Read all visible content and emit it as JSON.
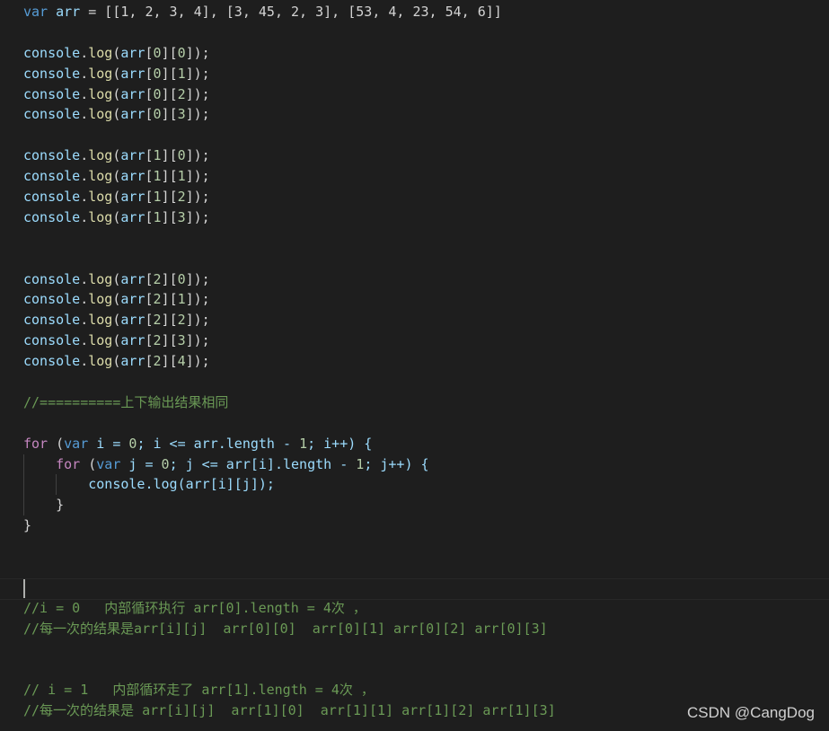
{
  "code": {
    "line_arr": {
      "kw": "var",
      "name": "arr",
      "rest": " = [[1, 2, 3, 4], [3, 45, 2, 3], [53, 4, 23, 54, 6]]"
    },
    "log_lines": [
      {
        "i": "0",
        "j": "0"
      },
      {
        "i": "0",
        "j": "1"
      },
      {
        "i": "0",
        "j": "2"
      },
      {
        "i": "0",
        "j": "3"
      },
      {
        "i": "1",
        "j": "0"
      },
      {
        "i": "1",
        "j": "1"
      },
      {
        "i": "1",
        "j": "2"
      },
      {
        "i": "1",
        "j": "3"
      },
      {
        "i": "2",
        "j": "0"
      },
      {
        "i": "2",
        "j": "1"
      },
      {
        "i": "2",
        "j": "2"
      },
      {
        "i": "2",
        "j": "3"
      },
      {
        "i": "2",
        "j": "4"
      }
    ],
    "comment_same": "//==========上下输出结果相同",
    "outer_for": {
      "kw": "for",
      "open": " (",
      "var": "var",
      "rest1": " i = ",
      "zero": "0",
      "rest2": "; i <= arr.length - ",
      "one": "1",
      "rest3": "; i++) {"
    },
    "inner_for": {
      "kw": "for",
      "open": " (",
      "var": "var",
      "rest1": " j = ",
      "zero": "0",
      "rest2": "; j <= arr[i].length - ",
      "one": "1",
      "rest3": "; j++) {"
    },
    "inner_log": "console.log(arr[i][j]);",
    "inner_close": "}",
    "outer_close": "}",
    "comment_i0_a": "//i = 0   内部循环执行 arr[0].length = 4次 ，",
    "comment_i0_b": "//每一次的结果是arr[i][j]  arr[0][0]  arr[0][1] arr[0][2] arr[0][3]",
    "comment_i1_a": "// i = 1   内部循环走了 arr[1].length = 4次 ，",
    "comment_i1_b": "//每一次的结果是 arr[i][j]  arr[1][0]  arr[1][1] arr[1][2] arr[1][3]"
  },
  "watermark": "CSDN @CangDog",
  "tokens": {
    "console": "console",
    "dot": ".",
    "log": "log",
    "paren_open": "(",
    "arr": "arr",
    "lb": "[",
    "rb": "]",
    "close": ");"
  }
}
